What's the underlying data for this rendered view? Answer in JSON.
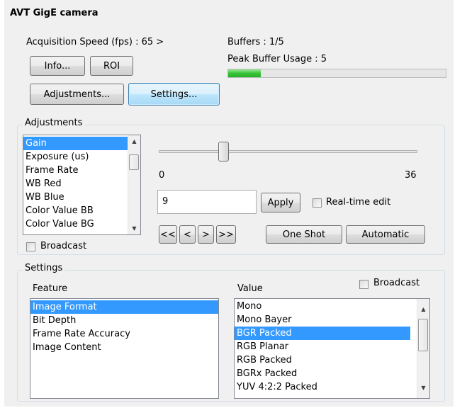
{
  "title": "AVT GigE camera",
  "acq_speed": "Acquisition Speed (fps) : 65 >",
  "buffers": "Buffers : 1/5",
  "peak_buffer": "Peak Buffer Usage : 5",
  "peak_buffer_progress": 0.15,
  "buttons": {
    "info": "Info...",
    "roi": "ROI",
    "adjustments": "Adjustments...",
    "settings": "Settings..."
  },
  "adjustments": {
    "legend": "Adjustments",
    "items": [
      "Gain",
      "Exposure (us)",
      "Frame Rate",
      "WB Red",
      "WB Blue",
      "Color Value BB",
      "Color Value BG"
    ],
    "selected_index": 0,
    "slider_min": "0",
    "slider_max": "36",
    "slider_value": 9,
    "value_input": "9",
    "apply": "Apply",
    "realtime_label": "Real-time edit",
    "broadcast_label": "Broadcast",
    "nav": [
      "<<",
      "<",
      ">",
      ">>"
    ],
    "one_shot": "One Shot",
    "automatic": "Automatic"
  },
  "settings": {
    "legend": "Settings",
    "feature_header": "Feature",
    "value_header": "Value",
    "broadcast_label": "Broadcast",
    "features": [
      "Image Format",
      "Bit Depth",
      "Frame Rate Accuracy",
      "Image Content"
    ],
    "feature_selected": 0,
    "values": [
      "Mono",
      "Mono Bayer",
      "BGR Packed",
      "RGB Planar",
      "RGB Packed",
      "BGRx Packed",
      "YUV 4:2:2 Packed"
    ],
    "value_selected": 2
  },
  "colors": {
    "selection": "#3399ff",
    "progress": "#37c336",
    "focus_border": "#3c7fb1"
  }
}
